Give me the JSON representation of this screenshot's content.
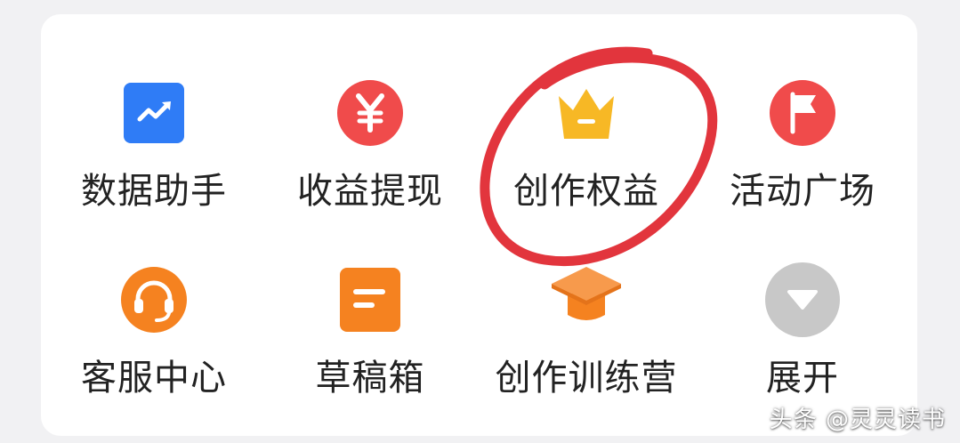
{
  "menu": {
    "items": [
      {
        "label": "数据助手",
        "icon": "trend-chart-icon",
        "color": "#2f7cf6"
      },
      {
        "label": "收益提现",
        "icon": "yen-icon",
        "color": "#f04b4b"
      },
      {
        "label": "创作权益",
        "icon": "crown-icon",
        "color": "#f7b825"
      },
      {
        "label": "活动广场",
        "icon": "flag-icon",
        "color": "#f04b4b"
      },
      {
        "label": "客服中心",
        "icon": "headset-icon",
        "color": "#f58220"
      },
      {
        "label": "草稿箱",
        "icon": "draft-icon",
        "color": "#f58220"
      },
      {
        "label": "创作训练营",
        "icon": "graduation-cap-icon",
        "color": "#f58220"
      },
      {
        "label": "展开",
        "icon": "expand-icon",
        "color": "#c8c8c8"
      }
    ]
  },
  "watermark": "头条 @灵灵读书",
  "annotation_color": "#e0242c"
}
